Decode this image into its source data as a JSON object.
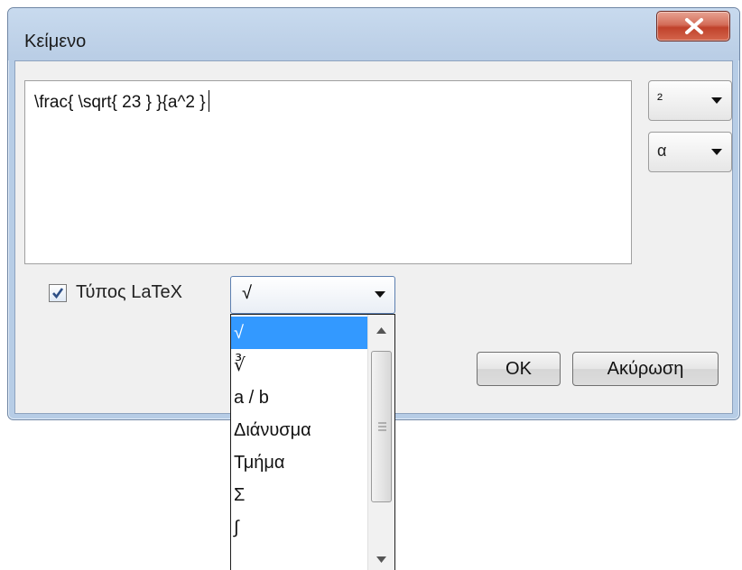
{
  "window": {
    "title": "Κείμενο",
    "close_label": "X",
    "accent": "#c0422b"
  },
  "editor": {
    "text": "\\frac{  \\sqrt{ 23 }  }{a^2 }"
  },
  "side_combos": {
    "superscript": {
      "label": "²"
    },
    "greek": {
      "label": "α"
    }
  },
  "latex": {
    "checkbox_label": "Τύπος LaTeX",
    "checked": true,
    "combo_selected": "√"
  },
  "buttons": {
    "ok": "OK",
    "cancel": "Ακύρωση"
  },
  "dropdown": {
    "items": [
      "√",
      "∛",
      "a / b",
      "Διάνυσμα",
      "Τμήμα",
      "Σ",
      "∫"
    ],
    "selected_index": 0,
    "selection_color": "#3399ff"
  }
}
